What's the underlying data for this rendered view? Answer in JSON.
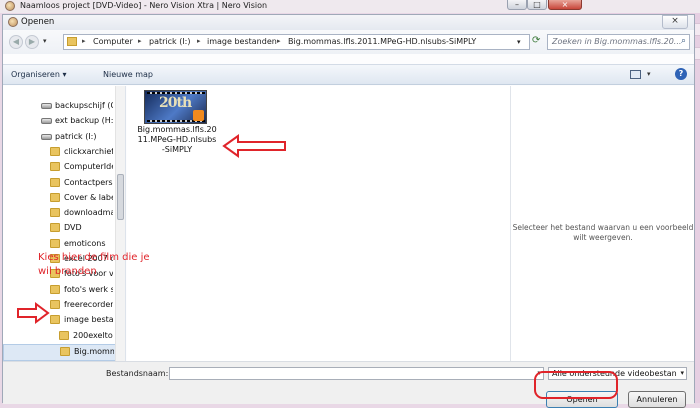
{
  "background_window": {
    "title": "Naamloos project [DVD-Video] - Nero Vision Xtra | Nero Vision",
    "caption_buttons": [
      "–",
      "□",
      "×"
    ]
  },
  "dialog": {
    "title": "Openen",
    "close_glyph": "×"
  },
  "address": {
    "crumbs": [
      "Computer",
      "patrick (I:)",
      "image bestanden",
      "Big.mommas.lfls.2011.MPeG-HD.nlsubs-SiMPLY"
    ],
    "separator": "▸",
    "search_placeholder": "Zoeken in Big.mommas.lfls.20..."
  },
  "toolbar": {
    "organize": "Organiseren ▾",
    "new_folder": "Nieuwe map"
  },
  "nav": {
    "items": [
      {
        "label": "backupschijf (G",
        "icon": "drive-icon",
        "indent": 38
      },
      {
        "label": "ext backup (H:)",
        "icon": "drive-icon",
        "indent": 38
      },
      {
        "label": "patrick (I:)",
        "icon": "drive-icon",
        "indent": 38
      },
      {
        "label": "clickxarchief",
        "icon": "folder-icon",
        "indent": 47
      },
      {
        "label": "ComputerIde",
        "icon": "folder-icon",
        "indent": 47
      },
      {
        "label": "Contactperso",
        "icon": "folder-icon",
        "indent": 47
      },
      {
        "label": "Cover & labe",
        "icon": "folder-icon",
        "indent": 47
      },
      {
        "label": "downloadma",
        "icon": "folder-icon",
        "indent": 47
      },
      {
        "label": "DVD",
        "icon": "folder-icon",
        "indent": 47
      },
      {
        "label": "emoticons",
        "icon": "folder-icon",
        "indent": 47
      },
      {
        "label": "excel 2007 co",
        "icon": "folder-icon",
        "indent": 47
      },
      {
        "label": "foto's voor ve",
        "icon": "folder-icon",
        "indent": 47
      },
      {
        "label": "foto's werk st",
        "icon": "folder-icon",
        "indent": 47
      },
      {
        "label": "freerecorder",
        "icon": "folder-icon",
        "indent": 47
      },
      {
        "label": "image bestar",
        "icon": "folder-icon",
        "indent": 47
      },
      {
        "label": "200exeltoep",
        "icon": "folder-icon",
        "indent": 56
      },
      {
        "label": "Big.momm",
        "icon": "folder-icon",
        "indent": 56,
        "selected": true
      }
    ]
  },
  "content": {
    "file_label": "Big.mommas.lfls.2011.MPeG-HD.nlsubs-SiMPLY",
    "thumb_text": "20th"
  },
  "preview": {
    "message": "Selecteer het bestand waarvan u een voorbeeld wilt weergeven."
  },
  "bottom": {
    "filename_label": "Bestandsnaam:",
    "filename_value": "",
    "filter": "Alle ondersteunde videobestan",
    "open": "Openen",
    "cancel": "Annuleren"
  },
  "annotation": {
    "text_line1": "Kies hier de film die je",
    "text_line2": "wil branden",
    "color": "#e0242a"
  }
}
